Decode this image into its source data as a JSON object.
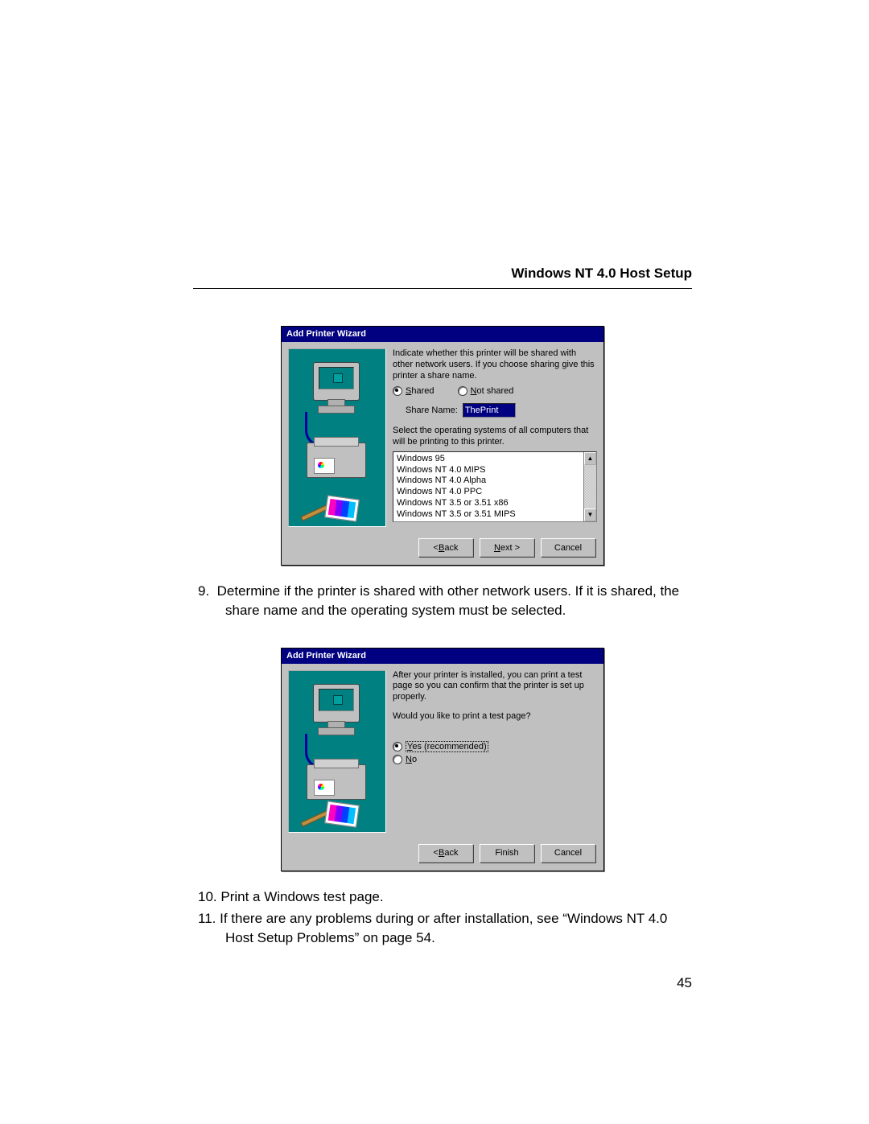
{
  "header": {
    "title": "Windows NT 4.0 Host Setup"
  },
  "page_number": "45",
  "dialog1": {
    "title": "Add Printer Wizard",
    "instruction": "Indicate whether this printer will be shared with other network users.  If you choose sharing give this printer a share name.",
    "radio_shared": "Shared",
    "radio_shared_key": "S",
    "radio_notshared": "Not shared",
    "radio_notshared_key": "N",
    "share_label": "Share Name:",
    "share_value": "ThePrint",
    "os_label": "Select the operating systems of all computers that will be printing to this printer.",
    "os_list": [
      "Windows 95",
      "Windows NT 4.0 MIPS",
      "Windows NT 4.0 Alpha",
      "Windows NT 4.0 PPC",
      "Windows NT 3.5 or 3.51 x86",
      "Windows NT 3.5 or 3.51 MIPS"
    ],
    "back": "< Back",
    "back_key": "B",
    "next": "Next >",
    "next_key": "N",
    "cancel": "Cancel"
  },
  "step9": "Determine if the printer is shared with other network users. If it is shared, the share name and the operating system must be selected.",
  "dialog2": {
    "title": "Add Printer Wizard",
    "line1": "After your printer is installed, you can print a test page so you can confirm that the printer is set up properly.",
    "line2": "Would you like to print a test page?",
    "yes": "Yes (recommended)",
    "yes_key": "Y",
    "no": "No",
    "no_key": "N",
    "back": "< Back",
    "back_key": "B",
    "finish": "Finish",
    "cancel": "Cancel"
  },
  "step10": "Print a Windows test page.",
  "step11": "If there are any problems during or after installation, see “Windows NT 4.0 Host Setup Problems” on page 54."
}
